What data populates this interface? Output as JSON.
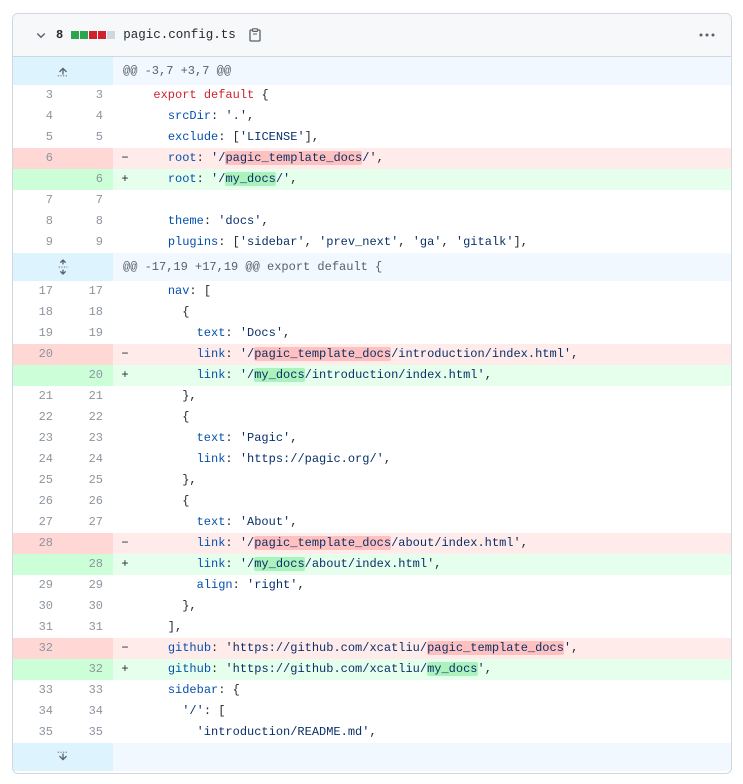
{
  "header": {
    "change_count": "8",
    "diffstat_colors": [
      "#2da44e",
      "#2da44e",
      "#cf222e",
      "#cf222e",
      "#d0d7de"
    ],
    "filename": "pagic.config.ts",
    "copy_icon": "clipboard-icon",
    "menu_icon": "kebab-horizontal-icon",
    "toggle_icon": "chevron-down-icon"
  },
  "colors": {
    "deletion_bg": "#ffebe9",
    "addition_bg": "#e6ffec",
    "hunk_bg": "#f1f8ff",
    "expand_bg": "#ddf4ff"
  },
  "hunks": [
    {
      "header": "@@ -3,7 +3,7 @@",
      "expand_icon": "fold-up-icon"
    },
    {
      "header": "@@ -17,19 +17,19 @@ export default {",
      "expand_icon": "unfold-icon"
    }
  ],
  "footer_expand_icon": "fold-down-icon",
  "lines": [
    {
      "t": "ctx",
      "l": "3",
      "r": "3",
      "tokens": [
        [
          "  ",
          ""
        ],
        [
          "export",
          "kw"
        ],
        [
          " ",
          ""
        ],
        [
          "default",
          "kw"
        ],
        [
          " {",
          ""
        ]
      ]
    },
    {
      "t": "ctx",
      "l": "4",
      "r": "4",
      "tokens": [
        [
          "    ",
          ""
        ],
        [
          "srcDir",
          "prop"
        ],
        [
          ": ",
          ""
        ],
        [
          "'.'",
          "str"
        ],
        [
          ",",
          ""
        ]
      ]
    },
    {
      "t": "ctx",
      "l": "5",
      "r": "5",
      "tokens": [
        [
          "    ",
          ""
        ],
        [
          "exclude",
          "prop"
        ],
        [
          ": [",
          ""
        ],
        [
          "'LICENSE'",
          "str"
        ],
        [
          "],",
          ""
        ]
      ]
    },
    {
      "t": "del",
      "l": "6",
      "r": "",
      "tokens": [
        [
          "    ",
          ""
        ],
        [
          "root",
          "prop"
        ],
        [
          ": ",
          ""
        ],
        [
          "'/",
          "str"
        ],
        [
          "pagic_template_docs",
          "str hl-del"
        ],
        [
          "/'",
          "str"
        ],
        [
          ",",
          ""
        ]
      ]
    },
    {
      "t": "add",
      "l": "",
      "r": "6",
      "tokens": [
        [
          "    ",
          ""
        ],
        [
          "root",
          "prop"
        ],
        [
          ": ",
          ""
        ],
        [
          "'/",
          "str"
        ],
        [
          "my_docs",
          "str hl-add"
        ],
        [
          "/'",
          "str"
        ],
        [
          ",",
          ""
        ]
      ]
    },
    {
      "t": "ctx",
      "l": "7",
      "r": "7",
      "tokens": [
        [
          "",
          ""
        ]
      ]
    },
    {
      "t": "ctx",
      "l": "8",
      "r": "8",
      "tokens": [
        [
          "    ",
          ""
        ],
        [
          "theme",
          "prop"
        ],
        [
          ": ",
          ""
        ],
        [
          "'docs'",
          "str"
        ],
        [
          ",",
          ""
        ]
      ]
    },
    {
      "t": "ctx",
      "l": "9",
      "r": "9",
      "tokens": [
        [
          "    ",
          ""
        ],
        [
          "plugins",
          "prop"
        ],
        [
          ": [",
          ""
        ],
        [
          "'sidebar'",
          "str"
        ],
        [
          ", ",
          ""
        ],
        [
          "'prev_next'",
          "str"
        ],
        [
          ", ",
          ""
        ],
        [
          "'ga'",
          "str"
        ],
        [
          ", ",
          ""
        ],
        [
          "'gitalk'",
          "str"
        ],
        [
          "],",
          ""
        ]
      ]
    },
    {
      "t": "hunk",
      "i": 1
    },
    {
      "t": "ctx",
      "l": "17",
      "r": "17",
      "tokens": [
        [
          "    ",
          ""
        ],
        [
          "nav",
          "prop"
        ],
        [
          ": [",
          ""
        ]
      ]
    },
    {
      "t": "ctx",
      "l": "18",
      "r": "18",
      "tokens": [
        [
          "      {",
          ""
        ]
      ]
    },
    {
      "t": "ctx",
      "l": "19",
      "r": "19",
      "tokens": [
        [
          "        ",
          ""
        ],
        [
          "text",
          "prop"
        ],
        [
          ": ",
          ""
        ],
        [
          "'Docs'",
          "str"
        ],
        [
          ",",
          ""
        ]
      ]
    },
    {
      "t": "del",
      "l": "20",
      "r": "",
      "tokens": [
        [
          "        ",
          ""
        ],
        [
          "link",
          "prop"
        ],
        [
          ": ",
          ""
        ],
        [
          "'/",
          "str"
        ],
        [
          "pagic_template_docs",
          "str hl-del"
        ],
        [
          "/introduction/index.html'",
          "str"
        ],
        [
          ",",
          ""
        ]
      ]
    },
    {
      "t": "add",
      "l": "",
      "r": "20",
      "tokens": [
        [
          "        ",
          ""
        ],
        [
          "link",
          "prop"
        ],
        [
          ": ",
          ""
        ],
        [
          "'/",
          "str"
        ],
        [
          "my_docs",
          "str hl-add"
        ],
        [
          "/introduction/index.html'",
          "str"
        ],
        [
          ",",
          ""
        ]
      ]
    },
    {
      "t": "ctx",
      "l": "21",
      "r": "21",
      "tokens": [
        [
          "      },",
          ""
        ]
      ]
    },
    {
      "t": "ctx",
      "l": "22",
      "r": "22",
      "tokens": [
        [
          "      {",
          ""
        ]
      ]
    },
    {
      "t": "ctx",
      "l": "23",
      "r": "23",
      "tokens": [
        [
          "        ",
          ""
        ],
        [
          "text",
          "prop"
        ],
        [
          ": ",
          ""
        ],
        [
          "'Pagic'",
          "str"
        ],
        [
          ",",
          ""
        ]
      ]
    },
    {
      "t": "ctx",
      "l": "24",
      "r": "24",
      "tokens": [
        [
          "        ",
          ""
        ],
        [
          "link",
          "prop"
        ],
        [
          ": ",
          ""
        ],
        [
          "'https://pagic.org/'",
          "str"
        ],
        [
          ",",
          ""
        ]
      ]
    },
    {
      "t": "ctx",
      "l": "25",
      "r": "25",
      "tokens": [
        [
          "      },",
          ""
        ]
      ]
    },
    {
      "t": "ctx",
      "l": "26",
      "r": "26",
      "tokens": [
        [
          "      {",
          ""
        ]
      ]
    },
    {
      "t": "ctx",
      "l": "27",
      "r": "27",
      "tokens": [
        [
          "        ",
          ""
        ],
        [
          "text",
          "prop"
        ],
        [
          ": ",
          ""
        ],
        [
          "'About'",
          "str"
        ],
        [
          ",",
          ""
        ]
      ]
    },
    {
      "t": "del",
      "l": "28",
      "r": "",
      "tokens": [
        [
          "        ",
          ""
        ],
        [
          "link",
          "prop"
        ],
        [
          ": ",
          ""
        ],
        [
          "'/",
          "str"
        ],
        [
          "pagic_template_docs",
          "str hl-del"
        ],
        [
          "/about/index.html'",
          "str"
        ],
        [
          ",",
          ""
        ]
      ]
    },
    {
      "t": "add",
      "l": "",
      "r": "28",
      "tokens": [
        [
          "        ",
          ""
        ],
        [
          "link",
          "prop"
        ],
        [
          ": ",
          ""
        ],
        [
          "'/",
          "str"
        ],
        [
          "my_docs",
          "str hl-add"
        ],
        [
          "/about/index.html'",
          "str"
        ],
        [
          ",",
          ""
        ]
      ]
    },
    {
      "t": "ctx",
      "l": "29",
      "r": "29",
      "tokens": [
        [
          "        ",
          ""
        ],
        [
          "align",
          "prop"
        ],
        [
          ": ",
          ""
        ],
        [
          "'right'",
          "str"
        ],
        [
          ",",
          ""
        ]
      ]
    },
    {
      "t": "ctx",
      "l": "30",
      "r": "30",
      "tokens": [
        [
          "      },",
          ""
        ]
      ]
    },
    {
      "t": "ctx",
      "l": "31",
      "r": "31",
      "tokens": [
        [
          "    ],",
          ""
        ]
      ]
    },
    {
      "t": "del",
      "l": "32",
      "r": "",
      "tokens": [
        [
          "    ",
          ""
        ],
        [
          "github",
          "prop"
        ],
        [
          ": ",
          ""
        ],
        [
          "'https://github.com/xcatliu/",
          "str"
        ],
        [
          "pagic_template_docs",
          "str hl-del"
        ],
        [
          "'",
          "str"
        ],
        [
          ",",
          ""
        ]
      ]
    },
    {
      "t": "add",
      "l": "",
      "r": "32",
      "tokens": [
        [
          "    ",
          ""
        ],
        [
          "github",
          "prop"
        ],
        [
          ": ",
          ""
        ],
        [
          "'https://github.com/xcatliu/",
          "str"
        ],
        [
          "my_docs",
          "str hl-add"
        ],
        [
          "'",
          "str"
        ],
        [
          ",",
          ""
        ]
      ]
    },
    {
      "t": "ctx",
      "l": "33",
      "r": "33",
      "tokens": [
        [
          "    ",
          ""
        ],
        [
          "sidebar",
          "prop"
        ],
        [
          ": {",
          ""
        ]
      ]
    },
    {
      "t": "ctx",
      "l": "34",
      "r": "34",
      "tokens": [
        [
          "      ",
          ""
        ],
        [
          "'/'",
          "str"
        ],
        [
          ": [",
          ""
        ]
      ]
    },
    {
      "t": "ctx",
      "l": "35",
      "r": "35",
      "tokens": [
        [
          "        ",
          ""
        ],
        [
          "'introduction/README.md'",
          "str"
        ],
        [
          ",",
          ""
        ]
      ]
    }
  ]
}
